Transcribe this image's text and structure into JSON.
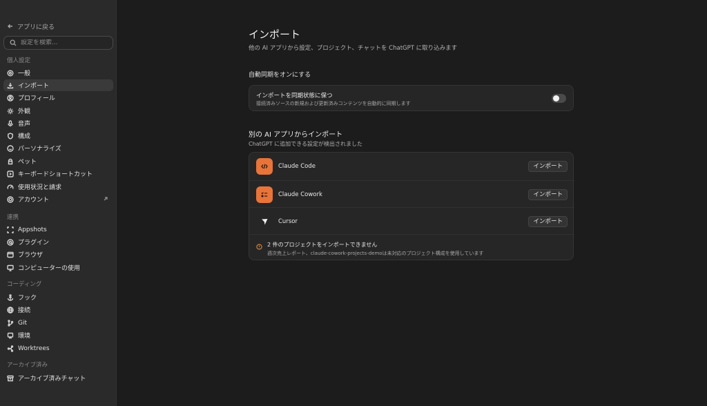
{
  "sidebar": {
    "back_label": "アプリに戻る",
    "search_placeholder": "設定を検索...",
    "sections": {
      "personal": "個人設定",
      "integrations": "連携",
      "coding": "コーディング",
      "archived": "アーカイブ済み"
    },
    "items": {
      "general": "一般",
      "import": "インポート",
      "profile": "プロフィール",
      "appearance": "外観",
      "voice": "音声",
      "configuration": "構成",
      "personalize": "パーソナライズ",
      "pets": "ペット",
      "shortcuts": "キーボードショートカット",
      "usage": "使用状況と請求",
      "account": "アカウント",
      "appshots": "Appshots",
      "plugins": "プラグイン",
      "browser": "ブラウザ",
      "computer_use": "コンピューターの使用",
      "hooks": "フック",
      "connections": "接続",
      "git": "Git",
      "environments": "環境",
      "worktrees": "Worktrees",
      "archived_chats": "アーカイブ済みチャット"
    },
    "active_item": "import"
  },
  "main": {
    "title": "インポート",
    "subtitle": "他の AI アプリから設定、プロジェクト、チャットを ChatGPT に取り込みます",
    "auto_sync_heading": "自動同期をオンにする",
    "sync_card": {
      "title": "インポートを同期状態に保つ",
      "description": "接続済みソースの新規および更新済みコンテンツを自動的に同期します",
      "enabled": false
    },
    "other_heading": "別の AI アプリからインポート",
    "other_subtitle": "ChatGPT に追加できる設定が検出されました",
    "apps": [
      {
        "name": "Claude Code",
        "icon": "code-icon",
        "button": "インポート"
      },
      {
        "name": "Claude Cowork",
        "icon": "checklist-icon",
        "button": "インポート"
      },
      {
        "name": "Cursor",
        "icon": "cursor-icon",
        "button": "インポート"
      }
    ],
    "warning": {
      "title": "2 件のプロジェクトをインポートできません",
      "description": "週次売上レポート、claude-cowork-projects-demoは未対応のプロジェクト構成を使用しています"
    }
  },
  "colors": {
    "accent_orange": "#e8743a",
    "warning_orange": "#e08a3c",
    "background": "#1c1c1c",
    "sidebar": "#2a2a2a"
  }
}
